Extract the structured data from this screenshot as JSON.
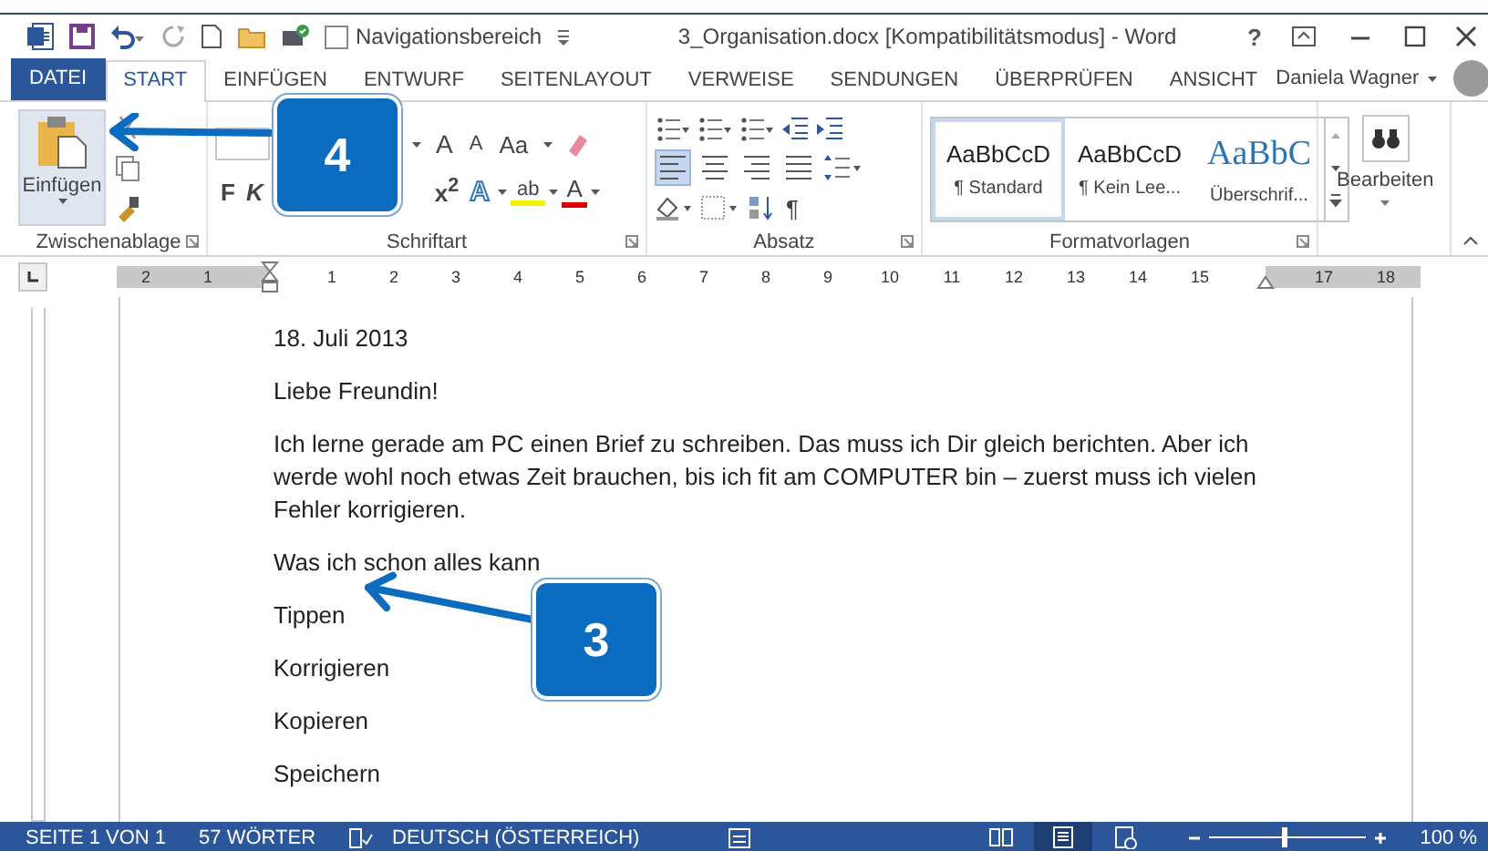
{
  "title_bar": {
    "nav_checkbox": {
      "label": "Navigationsbereich",
      "checked": false
    },
    "title": "3_Organisation.docx [Kompatibilitätsmodus] - Word",
    "help": "?"
  },
  "tabs": [
    {
      "label": "DATEI",
      "kind": "file",
      "selected": false
    },
    {
      "label": "START",
      "kind": "tab",
      "selected": true
    },
    {
      "label": "EINFÜGEN",
      "kind": "tab",
      "selected": false
    },
    {
      "label": "ENTWURF",
      "kind": "tab",
      "selected": false
    },
    {
      "label": "SEITENLAYOUT",
      "kind": "tab",
      "selected": false
    },
    {
      "label": "VERWEISE",
      "kind": "tab",
      "selected": false
    },
    {
      "label": "SENDUNGEN",
      "kind": "tab",
      "selected": false
    },
    {
      "label": "ÜBERPRÜFEN",
      "kind": "tab",
      "selected": false
    },
    {
      "label": "ANSICHT",
      "kind": "tab",
      "selected": false
    }
  ],
  "user": {
    "name": "Daniela Wagner"
  },
  "ribbon": {
    "clipboard": {
      "paste": "Einfügen",
      "label": "Zwischenablage"
    },
    "font": {
      "label": "Schriftart",
      "grow": "A",
      "shrink": "A",
      "case": "Aa",
      "bold": "F",
      "italic": "K",
      "superscript": "x$^{2}$",
      "effects": "A",
      "highlight": "ab",
      "font_color": "A"
    },
    "paragraph": {
      "label": "Absatz",
      "pilcrow": "¶",
      "align_buttons": [
        {
          "selected": true
        },
        {
          "selected": false
        },
        {
          "selected": false
        },
        {
          "selected": false
        }
      ]
    },
    "styles": {
      "label": "Formatvorlagen",
      "items": [
        {
          "sample": "AaBbCcD",
          "name": "¶ Standard",
          "kind": "body",
          "selected": true
        },
        {
          "sample": "AaBbCcD",
          "name": "¶ Kein Lee...",
          "kind": "body",
          "selected": false
        },
        {
          "sample": "AaBbC",
          "name": "Überschrif...",
          "kind": "heading",
          "selected": false
        }
      ]
    },
    "editing": {
      "label": "Bearbeiten"
    }
  },
  "ruler": {
    "labels": [
      "2",
      "1",
      "1",
      "2",
      "3",
      "4",
      "5",
      "6",
      "7",
      "8",
      "9",
      "10",
      "11",
      "12",
      "13",
      "14",
      "15",
      "17",
      "18"
    ]
  },
  "document": {
    "paragraphs": [
      "18. Juli 2013",
      "Liebe Freundin!",
      "Ich lerne gerade am PC einen Brief zu schreiben. Das muss ich Dir gleich berichten. Aber ich werde wohl noch etwas Zeit brauchen, bis ich fit am COMPUTER bin – zuerst muss ich vielen Fehler korrigieren.",
      "Was ich schon alles kann",
      "Tippen",
      "Korrigieren",
      "Kopieren",
      "Speichern"
    ]
  },
  "callouts": [
    {
      "number": "4"
    },
    {
      "number": "3"
    }
  ],
  "status_bar": {
    "page": "SEITE 1 VON 1",
    "words": "57 WÖRTER",
    "language": "DEUTSCH (ÖSTERREICH)",
    "views": [
      {
        "selected": false
      },
      {
        "selected": true
      },
      {
        "selected": false
      }
    ],
    "zoom": {
      "level": 0.5
    },
    "zoom_text": "100 %"
  }
}
